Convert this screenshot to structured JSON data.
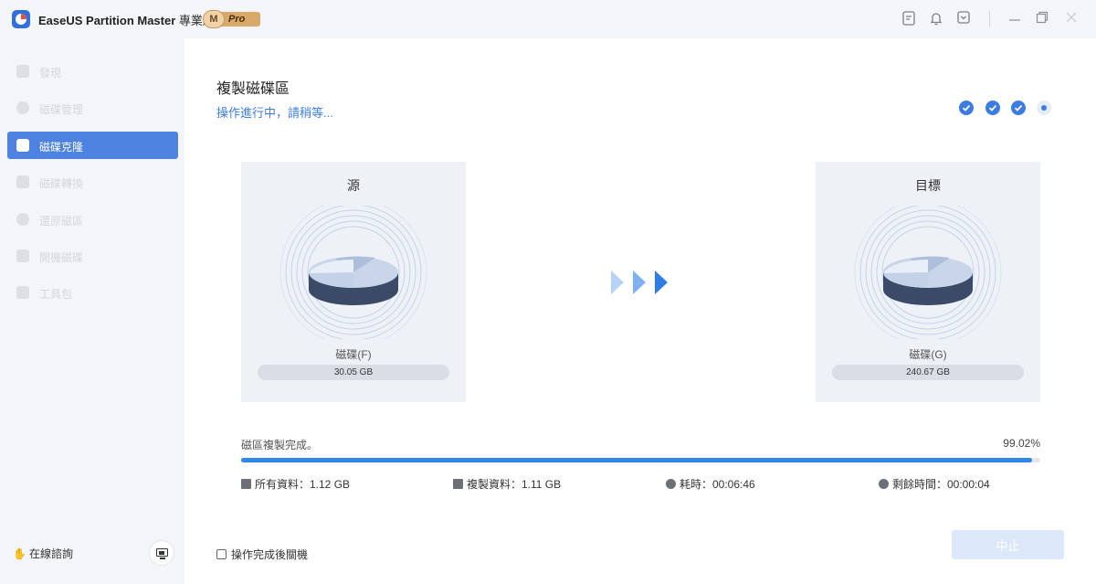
{
  "app": {
    "name": "EaseUS Partition Master",
    "edition": "專業版",
    "badge_letter": "M",
    "badge_label": "Pro"
  },
  "titlebar": {
    "icons": [
      "feedback-icon",
      "bell-icon",
      "dropdown-menu-icon",
      "minimize-icon",
      "restore-icon",
      "close-icon"
    ]
  },
  "sidebar": {
    "items": [
      {
        "label": "發現",
        "icon": "leaf-icon",
        "active": false
      },
      {
        "label": "磁碟管理",
        "icon": "pie-chart-icon",
        "active": false
      },
      {
        "label": "磁碟克隆",
        "icon": "clone-icon",
        "active": true
      },
      {
        "label": "磁碟轉換",
        "icon": "convert-icon",
        "active": false
      },
      {
        "label": "還原磁區",
        "icon": "recover-icon",
        "active": false
      },
      {
        "label": "開機磁碟",
        "icon": "usb-icon",
        "active": false
      },
      {
        "label": "工具包",
        "icon": "toolbox-icon",
        "active": false
      }
    ],
    "consult_label": "在線諮詢",
    "consult_icon": "waving-hand-icon",
    "chat_icon": "chat-monitor-icon"
  },
  "main": {
    "title": "複製磁碟區",
    "status": "操作進行中，請稍等...",
    "steps": [
      "done",
      "done",
      "done",
      "current"
    ],
    "source": {
      "title": "源",
      "disk_label": "磁碟(F)",
      "size": "30.05 GB"
    },
    "target": {
      "title": "目標",
      "disk_label": "磁碟(G)",
      "size": "240.67 GB"
    },
    "progress": {
      "label": "磁區複製完成。",
      "percent_text": "99.02%",
      "value": 0.9902
    },
    "stats": {
      "total": "所有資料：1.12 GB",
      "copied": "複製資料：1.11 GB",
      "elapsed": "耗時：00:06:46",
      "remaining": "剩餘時間：00:00:04"
    },
    "shutdown_label": "操作完成後關機",
    "stop_label": "中止"
  },
  "colors": {
    "accent": "#2f86e8",
    "sidebar_active": "#4d82e0",
    "status_text": "#3d7fe0",
    "stop_button": "#dbe8fa"
  }
}
